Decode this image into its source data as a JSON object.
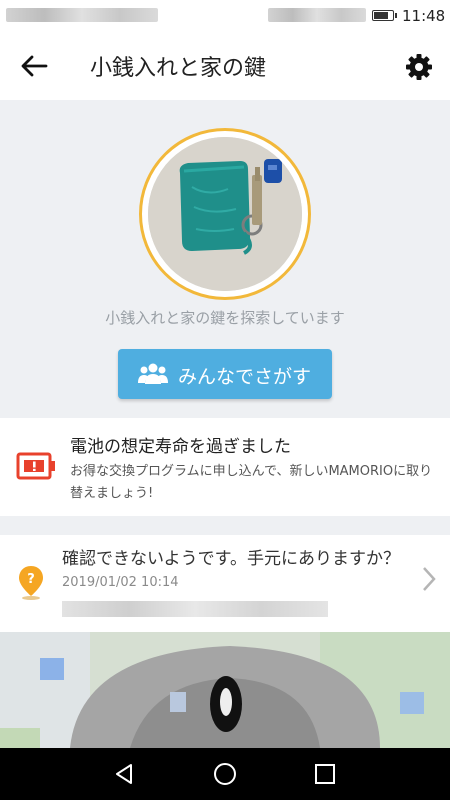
{
  "status_bar": {
    "time": "11:48"
  },
  "header": {
    "title": "小銭入れと家の鍵"
  },
  "hero": {
    "status_text": "小銭入れと家の鍵を探索しています",
    "community_search_label": "みんなでさがす"
  },
  "battery_notice": {
    "title": "電池の想定寿命を過ぎました",
    "description": "お得な交換プログラムに申し込んで、新しいMAMORIOに取り替えましょう!"
  },
  "location_card": {
    "title": "確認できないようです。手元にありますか？",
    "timestamp": "2019/01/02 10:14"
  },
  "colors": {
    "accent": "#4faee0",
    "ring": "#f2b83a",
    "warning": "#e8412c",
    "pin": "#f5a623",
    "hero_bg": "#eef0f3"
  },
  "icons": {
    "back": "arrow-left-icon",
    "settings": "gear-icon",
    "community": "people-group-icon",
    "battery": "battery-warning-icon",
    "location": "location-pin-question-icon",
    "chevron": "chevron-right-icon",
    "nav_back": "triangle-back-icon",
    "nav_home": "circle-home-icon",
    "nav_recent": "square-recent-icon"
  }
}
